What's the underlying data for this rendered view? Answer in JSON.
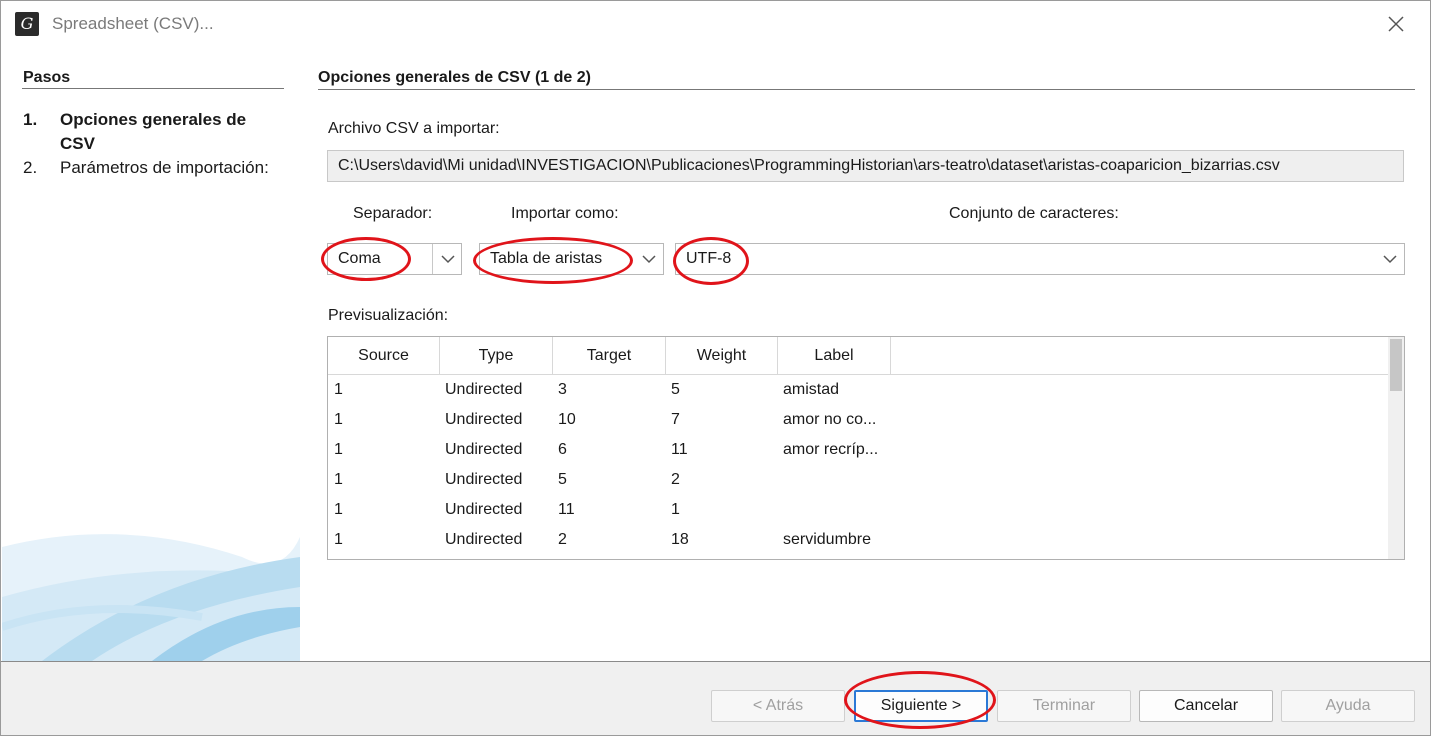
{
  "window": {
    "title": "Spreadsheet (CSV)...",
    "app_icon_glyph": "G"
  },
  "steps": {
    "header": "Pasos",
    "items": [
      {
        "num": "1.",
        "label": "Opciones generales de CSV",
        "active": true
      },
      {
        "num": "2.",
        "label": "Parámetros de importación:",
        "active": false
      }
    ]
  },
  "main": {
    "section_title": "Opciones generales de CSV (1 de 2)",
    "file_label": "Archivo CSV a importar:",
    "file_path": "C:\\Users\\david\\Mi unidad\\INVESTIGACION\\Publicaciones\\ProgrammingHistorian\\ars-teatro\\dataset\\aristas-coaparicion_bizarrias.csv",
    "separator_label": "Separador:",
    "separator_value": "Coma",
    "import_as_label": "Importar como:",
    "import_as_value": "Tabla de aristas",
    "charset_label": "Conjunto de caracteres:",
    "charset_value": "UTF-8",
    "preview_label": "Previsualización:"
  },
  "preview": {
    "columns": [
      "Source",
      "Type",
      "Target",
      "Weight",
      "Label"
    ],
    "rows": [
      [
        "1",
        "Undirected",
        "3",
        "5",
        "amistad"
      ],
      [
        "1",
        "Undirected",
        "10",
        "7",
        "amor no co..."
      ],
      [
        "1",
        "Undirected",
        "6",
        "11",
        "amor recríp..."
      ],
      [
        "1",
        "Undirected",
        "5",
        "2",
        ""
      ],
      [
        "1",
        "Undirected",
        "11",
        "1",
        ""
      ],
      [
        "1",
        "Undirected",
        "2",
        "18",
        "servidumbre"
      ]
    ]
  },
  "buttons": {
    "back": "< Atrás",
    "next": "Siguiente >",
    "finish": "Terminar",
    "cancel": "Cancelar",
    "help": "Ayuda"
  },
  "colors": {
    "annotation": "#e0141a",
    "focus_border": "#2b79d6",
    "bottom_bar": "#f0f0f0"
  }
}
